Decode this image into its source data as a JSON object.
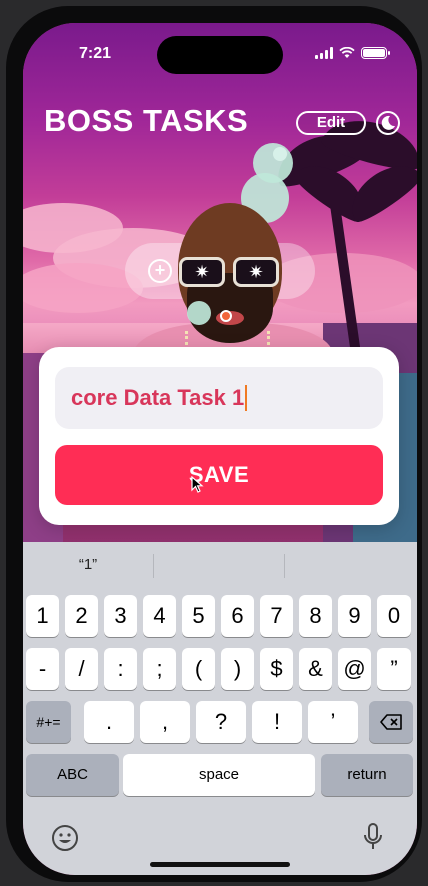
{
  "status_bar": {
    "time": "7:21"
  },
  "header": {
    "title": "BOSS TASKS",
    "edit_label": "Edit"
  },
  "task_input": {
    "value": "core Data Task 1"
  },
  "save_button": {
    "label": "SAVE"
  },
  "keyboard": {
    "predictions": [
      "“1”",
      "",
      ""
    ],
    "row1": [
      "1",
      "2",
      "3",
      "4",
      "5",
      "6",
      "7",
      "8",
      "9",
      "0"
    ],
    "row2": [
      "-",
      "/",
      ":",
      ";",
      "(",
      ")",
      "$",
      "&",
      "@",
      "”"
    ],
    "row3_toggle": "#+=",
    "row3": [
      ".",
      ",",
      "?",
      "!",
      "’"
    ],
    "abc_label": "ABC",
    "space_label": "space",
    "return_label": "return"
  },
  "colors": {
    "accent": "#ff2d55",
    "task_text": "#d8365a",
    "field_bg": "#f0eff4",
    "keyboard_bg": "#d1d3d9"
  },
  "icons": [
    "moon-icon",
    "backspace-icon",
    "emoji-icon",
    "microphone-icon",
    "cellular-signal-icon",
    "wifi-icon",
    "battery-icon",
    "plus-circle-icon",
    "pointer-cursor-icon"
  ]
}
